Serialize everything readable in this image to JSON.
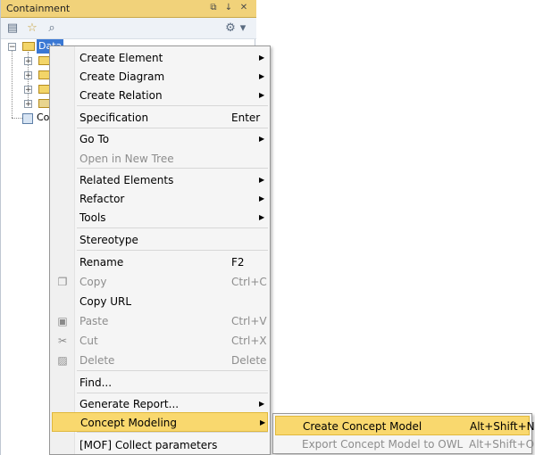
{
  "panel": {
    "title": "Containment",
    "title_buttons": [
      "⧉",
      "↓",
      "✕"
    ],
    "tools": {
      "folder": "▤",
      "star": "☆",
      "search": "⌕",
      "gear": "⚙",
      "dropdown": "▾"
    }
  },
  "tree": {
    "root_label": "Data",
    "child_label": "Co"
  },
  "menu": {
    "items": [
      {
        "label": "Create Element",
        "shortcut": "",
        "submenu": true,
        "disabled": false
      },
      {
        "label": "Create Diagram",
        "shortcut": "",
        "submenu": true,
        "disabled": false
      },
      {
        "label": "Create Relation",
        "shortcut": "",
        "submenu": true,
        "disabled": false
      },
      {
        "label": "Specification",
        "shortcut": "Enter",
        "submenu": false,
        "disabled": false
      },
      {
        "label": "Go To",
        "shortcut": "",
        "submenu": true,
        "disabled": false
      },
      {
        "label": "Open in New Tree",
        "shortcut": "",
        "submenu": false,
        "disabled": true
      },
      {
        "label": "Related Elements",
        "shortcut": "",
        "submenu": true,
        "disabled": false
      },
      {
        "label": "Refactor",
        "shortcut": "",
        "submenu": true,
        "disabled": false
      },
      {
        "label": "Tools",
        "shortcut": "",
        "submenu": true,
        "disabled": false
      },
      {
        "label": "Stereotype",
        "shortcut": "",
        "submenu": false,
        "disabled": false
      },
      {
        "label": "Rename",
        "shortcut": "F2",
        "submenu": false,
        "disabled": false
      },
      {
        "label": "Copy",
        "shortcut": "Ctrl+C",
        "submenu": false,
        "disabled": true,
        "icon": "copy"
      },
      {
        "label": "Copy URL",
        "shortcut": "",
        "submenu": false,
        "disabled": false
      },
      {
        "label": "Paste",
        "shortcut": "Ctrl+V",
        "submenu": false,
        "disabled": true,
        "icon": "paste"
      },
      {
        "label": "Cut",
        "shortcut": "Ctrl+X",
        "submenu": false,
        "disabled": true,
        "icon": "cut"
      },
      {
        "label": "Delete",
        "shortcut": "Delete",
        "submenu": false,
        "disabled": true,
        "icon": "delete"
      },
      {
        "label": "Find...",
        "shortcut": "",
        "submenu": false,
        "disabled": false
      },
      {
        "label": "Generate Report...",
        "shortcut": "",
        "submenu": true,
        "disabled": false
      },
      {
        "label": "Concept Modeling",
        "shortcut": "",
        "submenu": true,
        "disabled": false,
        "selected": true
      },
      {
        "label": "[MOF] Collect parameters",
        "shortcut": "",
        "submenu": false,
        "disabled": false
      }
    ],
    "arrow_glyph": "▶",
    "icon_glyphs": {
      "copy": "❐",
      "paste": "▣",
      "cut": "✂",
      "delete": "▨"
    }
  },
  "submenu": {
    "items": [
      {
        "label": "Create Concept Model",
        "shortcut": "Alt+Shift+N",
        "disabled": false,
        "selected": true
      },
      {
        "label": "Export Concept Model to OWL",
        "shortcut": "Alt+Shift+O",
        "disabled": true
      }
    ]
  },
  "colors": {
    "highlight": "#f9d86e",
    "titlebar": "#f1d27a"
  }
}
